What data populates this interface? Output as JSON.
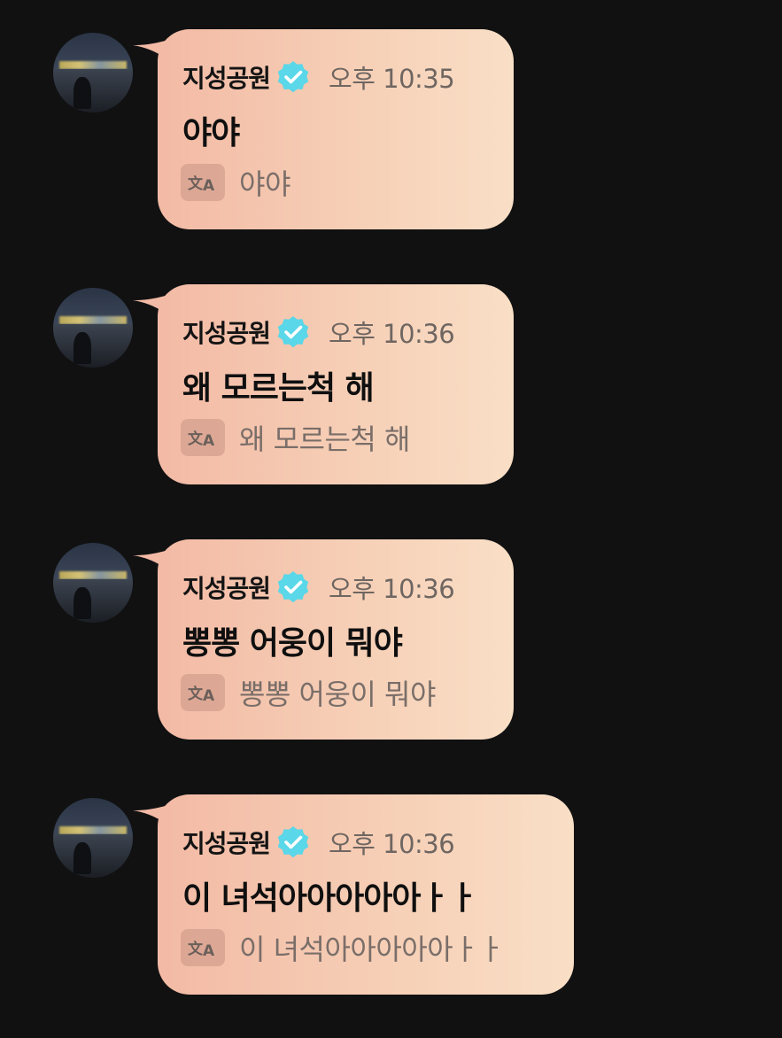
{
  "messages": [
    {
      "sender": "지성공원",
      "time": "오후 10:35",
      "text": "야야",
      "translation": "야야"
    },
    {
      "sender": "지성공원",
      "time": "오후 10:36",
      "text": "왜 모르는척 해",
      "translation": "왜 모르는척 해"
    },
    {
      "sender": "지성공원",
      "time": "오후 10:36",
      "text": "뽕뽕 어웅이 뭐야",
      "translation": "뽕뽕 어웅이 뭐야"
    },
    {
      "sender": "지성공원",
      "time": "오후 10:36",
      "text": "이 녀석아아아아아ㅏㅏ",
      "translation": "이 녀석아아아아아ㅏㅏ"
    }
  ],
  "icons": {
    "avatar": "profile-photo",
    "verified": "verified-badge-icon",
    "translate": "translate-icon"
  },
  "colors": {
    "background": "#111112",
    "bubble_start": "#f3baa5",
    "bubble_end": "#f9dfc6",
    "verified": "#5ad7e8"
  }
}
